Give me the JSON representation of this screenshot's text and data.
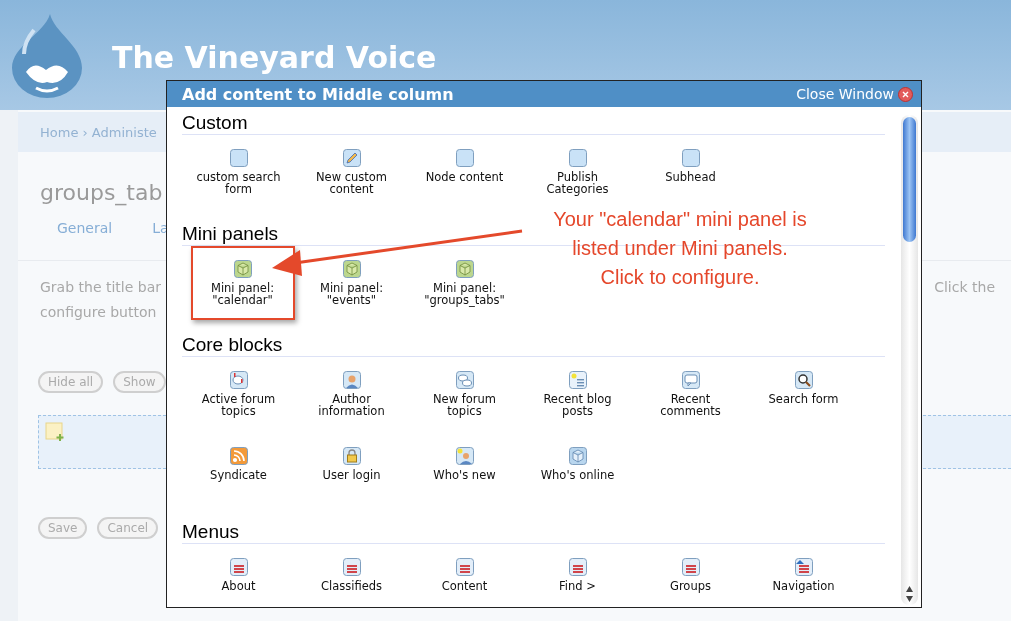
{
  "site": {
    "title": "The Vineyard Voice"
  },
  "breadcrumb": "Home › Administe",
  "page_title": "groups_tab",
  "tabs": [
    {
      "label": "General",
      "selected": false
    },
    {
      "label": "La",
      "selected": false
    }
  ],
  "instructions": {
    "left_lines": [
      "Grab the title bar",
      "configure button"
    ],
    "right_fragment": "Click the"
  },
  "top_buttons": [
    "Hide all",
    "Show"
  ],
  "bottom_buttons": [
    "Save",
    "Cancel"
  ],
  "modal": {
    "title": "Add content to Middle column",
    "close_label": "Close Window",
    "sections": [
      {
        "title": "Custom",
        "items": [
          {
            "label": "custom search form",
            "kind": "block",
            "highlighted": false
          },
          {
            "label": "New custom content",
            "kind": "edit",
            "highlighted": false
          },
          {
            "label": "Node content",
            "kind": "block",
            "highlighted": false
          },
          {
            "label": "Publish Categories",
            "kind": "block",
            "highlighted": false
          },
          {
            "label": "Subhead",
            "kind": "block",
            "highlighted": false
          }
        ]
      },
      {
        "title": "Mini panels",
        "items": [
          {
            "label": "Mini panel: \"calendar\"",
            "kind": "cube",
            "highlighted": true
          },
          {
            "label": "Mini panel: \"events\"",
            "kind": "cube",
            "highlighted": false
          },
          {
            "label": "Mini panel: \"groups_tabs\"",
            "kind": "cube",
            "highlighted": false
          }
        ]
      },
      {
        "title": "Core blocks",
        "items": [
          {
            "label": "Active forum topics",
            "kind": "forum-alert",
            "highlighted": false
          },
          {
            "label": "Author information",
            "kind": "person",
            "highlighted": false
          },
          {
            "label": "New forum topics",
            "kind": "forum",
            "highlighted": false
          },
          {
            "label": "Recent blog posts",
            "kind": "blog",
            "highlighted": false
          },
          {
            "label": "Recent comments",
            "kind": "comment",
            "highlighted": false
          },
          {
            "label": "Search form",
            "kind": "search",
            "highlighted": false
          },
          {
            "label": "Syndicate",
            "kind": "feed",
            "highlighted": false
          },
          {
            "label": "User login",
            "kind": "lock",
            "highlighted": false
          },
          {
            "label": "Who's new",
            "kind": "person-new",
            "highlighted": false
          },
          {
            "label": "Who's online",
            "kind": "box",
            "highlighted": false
          }
        ]
      },
      {
        "title": "Menus",
        "items": [
          {
            "label": "About",
            "kind": "menu",
            "highlighted": false
          },
          {
            "label": "Classifieds",
            "kind": "menu",
            "highlighted": false
          },
          {
            "label": "Content",
            "kind": "menu",
            "highlighted": false
          },
          {
            "label": "Find >",
            "kind": "menu",
            "highlighted": false
          },
          {
            "label": "Groups",
            "kind": "menu",
            "highlighted": false
          },
          {
            "label": "Navigation",
            "kind": "menu-home",
            "highlighted": false
          }
        ]
      }
    ]
  },
  "callout": {
    "text": "Your \"calendar\" mini panel is\nlisted under Mini panels.\nClick to configure."
  }
}
